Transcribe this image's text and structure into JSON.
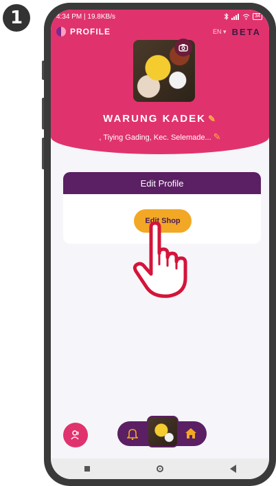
{
  "step": {
    "number": "1"
  },
  "status_bar": {
    "time_speed": "4:34 PM | 19.8KB/s",
    "battery": "34"
  },
  "header": {
    "title": "PROFILE",
    "language": "EN",
    "badge": "BETA"
  },
  "shop": {
    "name": "WARUNG KADEK",
    "address": ", Tiying Gading, Kec. Selemade..."
  },
  "card": {
    "title": "Edit Profile",
    "button_label": "Edit Shop"
  },
  "colors": {
    "header": "#e0336e",
    "purple": "#5b1f63",
    "accent": "#f2a825"
  },
  "icons": [
    "camera-icon",
    "pencil-icon",
    "user-icon",
    "bell-icon",
    "home-icon",
    "pointer-hand-icon"
  ]
}
